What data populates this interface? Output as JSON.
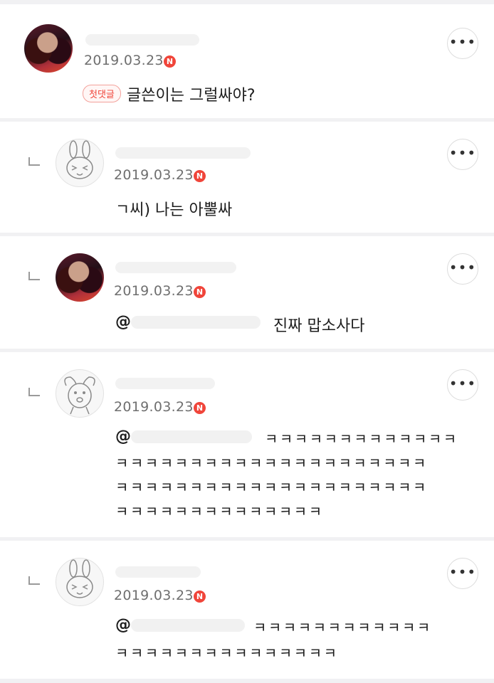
{
  "comments": [
    {
      "date": "2019.03.23",
      "new_badge": "N",
      "first_badge": "첫댓글",
      "text": "글쓴이는 그럴싸야?",
      "more": "•••"
    },
    {
      "date": "2019.03.23",
      "new_badge": "N",
      "text": "ㄱ씨) 나는 아뿔싸",
      "more": "•••"
    },
    {
      "date": "2019.03.23",
      "new_badge": "N",
      "mention": "@",
      "text": "진짜 맙소사다",
      "more": "•••"
    },
    {
      "date": "2019.03.23",
      "new_badge": "N",
      "mention": "@",
      "lines": [
        "ㅋㅋㅋㅋㅋㅋㅋㅋㅋㅋㅋㅋㅋ",
        "ㅋㅋㅋㅋㅋㅋㅋㅋㅋㅋㅋㅋㅋㅋㅋㅋㅋㅋㅋㅋㅋ",
        "ㅋㅋㅋㅋㅋㅋㅋㅋㅋㅋㅋㅋㅋㅋㅋㅋㅋㅋㅋㅋㅋ",
        "ㅋㅋㅋㅋㅋㅋㅋㅋㅋㅋㅋㅋㅋㅋ"
      ],
      "more": "•••"
    },
    {
      "date": "2019.03.23",
      "new_badge": "N",
      "mention": "@",
      "lines": [
        "ㅋㅋㅋㅋㅋㅋㅋㅋㅋㅋㅋㅋ",
        "ㅋㅋㅋㅋㅋㅋㅋㅋㅋㅋㅋㅋㅋㅋㅋ"
      ],
      "more": "•••"
    }
  ],
  "icons": {
    "more": "more-horizontal-icon",
    "reply": "reply-arrow-icon",
    "new": "new-badge-icon"
  },
  "colors": {
    "accent": "#f0453a",
    "background": "#f1f1f3",
    "card": "#ffffff"
  }
}
